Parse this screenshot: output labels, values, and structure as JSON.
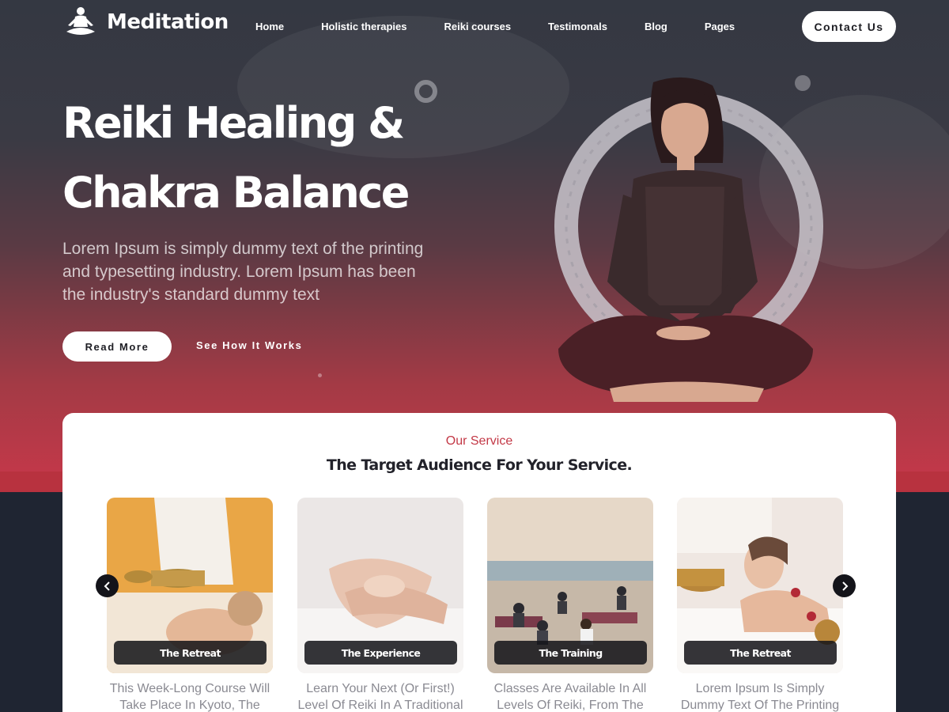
{
  "brand": {
    "name": "Meditation"
  },
  "nav": {
    "items": [
      {
        "label": "Home"
      },
      {
        "label": "Holistic therapies"
      },
      {
        "label": "Reiki courses"
      },
      {
        "label": "Testimonals"
      },
      {
        "label": "Blog"
      },
      {
        "label": "Pages"
      }
    ],
    "cta_label": "Contact Us"
  },
  "hero": {
    "title_line1": "Reiki Healing &",
    "title_line2": "Chakra Balance",
    "description": "Lorem Ipsum is simply dummy text of the printing and typesetting industry. Lorem Ipsum has been the industry's standard dummy text",
    "primary_button": "Read More",
    "secondary_link": "See How It Works"
  },
  "service": {
    "eyebrow": "Our Service",
    "heading": "The Target Audience For Your Service.",
    "cards": [
      {
        "label": "The Retreat",
        "text": "This Week-Long Course Will Take Place In Kyoto, The"
      },
      {
        "label": "The Experience",
        "text": "Learn Your Next (Or First!) Level Of Reiki In A Traditional"
      },
      {
        "label": "The Training",
        "text": "Classes Are Available In All Levels Of Reiki, From The"
      },
      {
        "label": "The Retreat",
        "text": "Lorem Ipsum Is Simply Dummy Text Of The Printing"
      }
    ]
  },
  "icons": {
    "logo": "meditating-person-icon",
    "prev": "chevron-left-icon",
    "next": "chevron-right-icon"
  },
  "colors": {
    "accent_red": "#c33846",
    "hero_top": "#343842",
    "hero_bottom": "#c8384a",
    "dark_base": "#1f2532"
  }
}
